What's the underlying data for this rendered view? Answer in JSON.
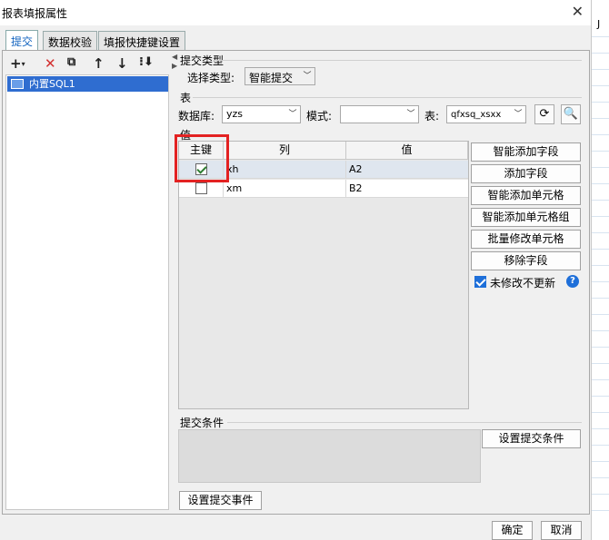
{
  "window": {
    "title": "报表填报属性",
    "close_glyph": "✕",
    "right_strip_letter": "J"
  },
  "tabs": [
    "提交",
    "数据校验",
    "填报快捷键设置"
  ],
  "left_panel": {
    "toolbar": [
      "add-icon",
      "delete-icon",
      "copy-icon",
      "move-up-icon",
      "move-down-icon",
      "sort-icon"
    ],
    "items": [
      "内置SQL1"
    ]
  },
  "submit_type": {
    "section_label": "提交类型",
    "select_label": "选择类型:",
    "select_value": "智能提交"
  },
  "table_section": {
    "section_label": "表",
    "db_label": "数据库:",
    "db_value": "yzs",
    "schema_label": "模式:",
    "schema_value": "",
    "table_label": "表:",
    "table_value": "qfxsq_xsxx"
  },
  "value_section": {
    "section_label": "值",
    "headers": [
      "主键",
      "列",
      "值"
    ],
    "rows": [
      {
        "key": true,
        "column": "xh",
        "value": "A2"
      },
      {
        "key": false,
        "column": "xm",
        "value": "B2"
      }
    ]
  },
  "side_buttons": [
    "智能添加字段",
    "添加字段",
    "智能添加单元格",
    "智能添加单元格组",
    "批量修改单元格",
    "移除字段"
  ],
  "no_update_unmodified": {
    "label": "未修改不更新",
    "checked": true
  },
  "submit_condition": {
    "section_label": "提交条件",
    "button": "设置提交条件"
  },
  "submit_event_button": "设置提交事件",
  "footer": {
    "ok": "确定",
    "cancel": "取消"
  },
  "colors": {
    "highlight": "#e32222",
    "selection": "#2f6dd0",
    "accent": "#1e6fd9"
  }
}
